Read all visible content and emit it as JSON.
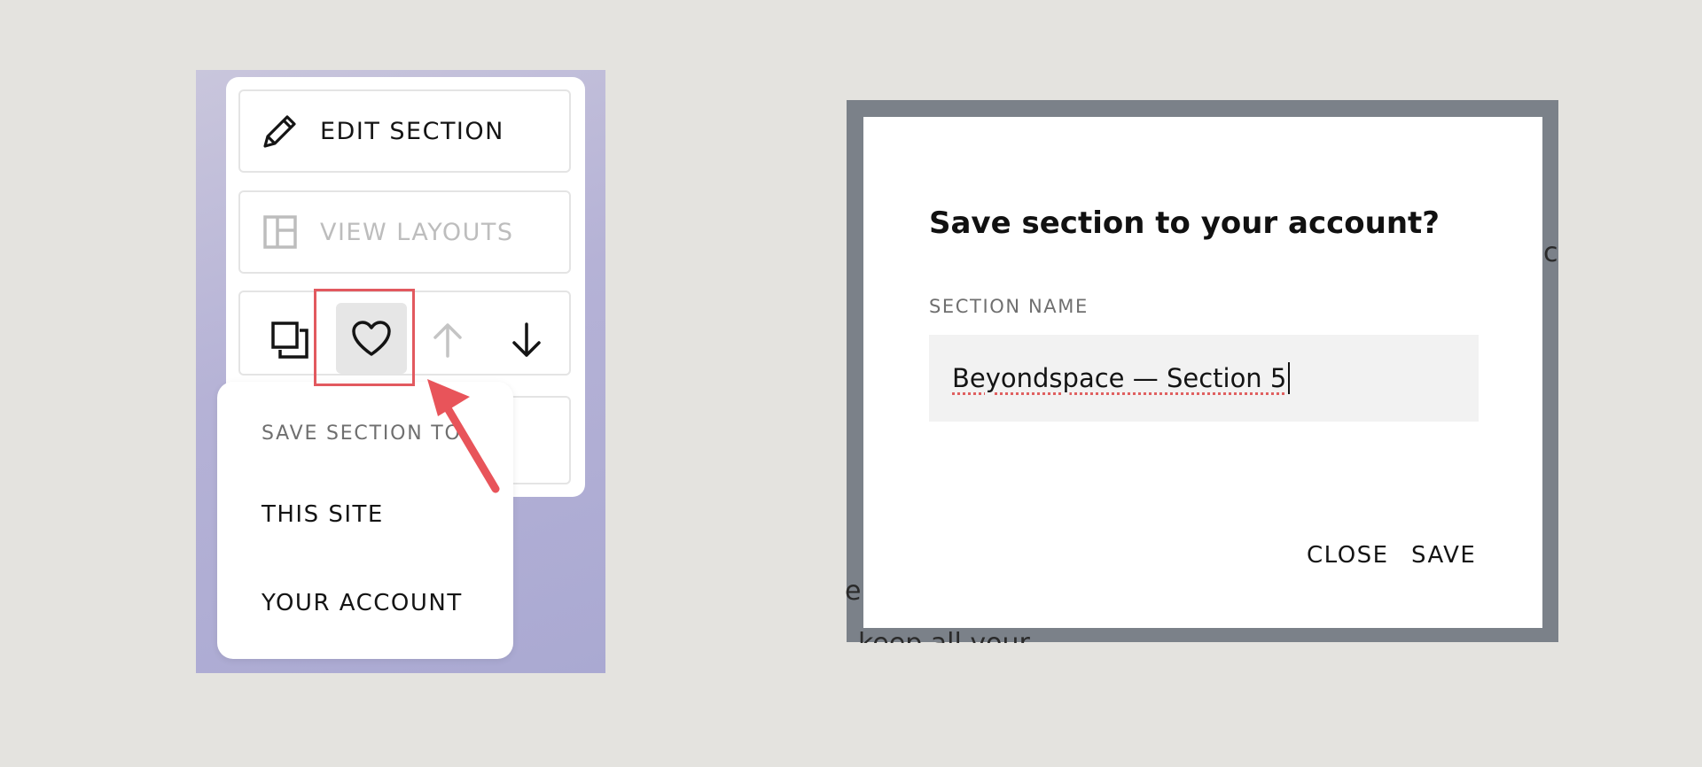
{
  "left_menu": {
    "edit_section": "EDIT SECTION",
    "view_layouts": "VIEW LAYOUTS",
    "row_icons": [
      "duplicate-icon",
      "heart-icon",
      "arrow-up-icon",
      "arrow-down-icon"
    ]
  },
  "dropdown": {
    "heading": "SAVE SECTION TO",
    "items": [
      "THIS SITE",
      "YOUR ACCOUNT"
    ]
  },
  "dialog": {
    "title": "Save section to your account?",
    "field_label": "SECTION NAME",
    "field_value": "Beyondspace — Section 5",
    "close_label": "CLOSE",
    "save_label": "SAVE"
  },
  "background_text": {
    "fragment_right": "c",
    "fragment_left": "e",
    "fragment_bottom": "keep all your"
  },
  "colors": {
    "highlight": "#e2595f",
    "arrow": "#e8545a",
    "overlay": "#7b8189",
    "panel_gradient": "#b5b2d6"
  }
}
